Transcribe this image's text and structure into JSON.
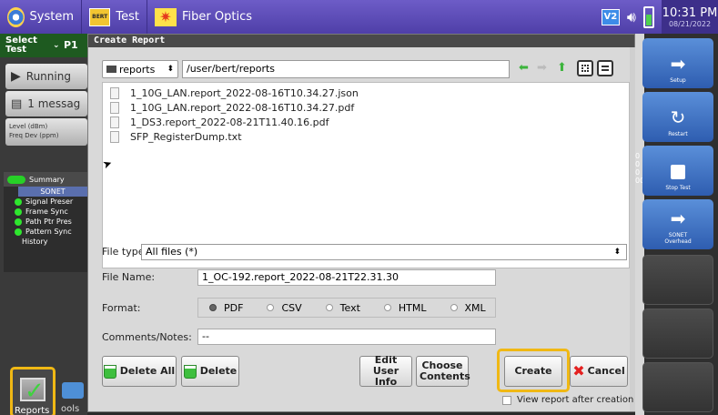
{
  "topbar": {
    "system_label": "System",
    "test_label": "Test",
    "bert_icon_text": "BERT",
    "fiber_label": "Fiber Optics",
    "v2_label": "V2",
    "time": "10:31 PM",
    "date": "08/21/2022"
  },
  "left": {
    "select_test": "Select Test",
    "select_test_suffix": "P1",
    "running": "Running",
    "messages": "1 messag",
    "level_line1": "Level (dBm)",
    "level_line2": "Freq Dev (ppm)",
    "summary": "Summary",
    "sonet": "SONET",
    "tree": [
      "Signal Preser",
      "Frame Sync",
      "Path Ptr Pres",
      "Pattern Sync",
      "History"
    ],
    "reports": "Reports",
    "tools": "ools"
  },
  "right": {
    "setup": "Setup",
    "restart": "Restart",
    "stop_test": "Stop Test",
    "sonet_overhead": "SONET Overhead",
    "behind_values": [
      "0",
      "0",
      "0",
      "00"
    ]
  },
  "dialog": {
    "title": "Create Report",
    "dir": "reports",
    "path": "/user/bert/reports",
    "files": [
      "1_10G_LAN.report_2022-08-16T10.34.27.json",
      "1_10G_LAN.report_2022-08-16T10.34.27.pdf",
      "1_DS3.report_2022-08-21T11.40.16.pdf",
      "SFP_RegisterDump.txt"
    ],
    "file_type_label": "File type:",
    "file_type_value": "All files (*)",
    "file_name_label": "File Name:",
    "file_name_value": "1_OC-192.report_2022-08-21T22.31.30",
    "format_label": "Format:",
    "formats": [
      "PDF",
      "CSV",
      "Text",
      "HTML",
      "XML"
    ],
    "selected_format": "PDF",
    "comments_label": "Comments/Notes:",
    "comments_value": "--",
    "delete_all": "Delete All",
    "delete": "Delete",
    "edit_user_info": "Edit User Info",
    "choose_contents": "Choose Contents",
    "create": "Create",
    "cancel": "Cancel",
    "view_after": "View report after creation"
  },
  "colors": {
    "topbar": "#5a49b8",
    "highlight": "#f0b814",
    "running_green": "#27d027",
    "cancel_red": "#e42020"
  }
}
